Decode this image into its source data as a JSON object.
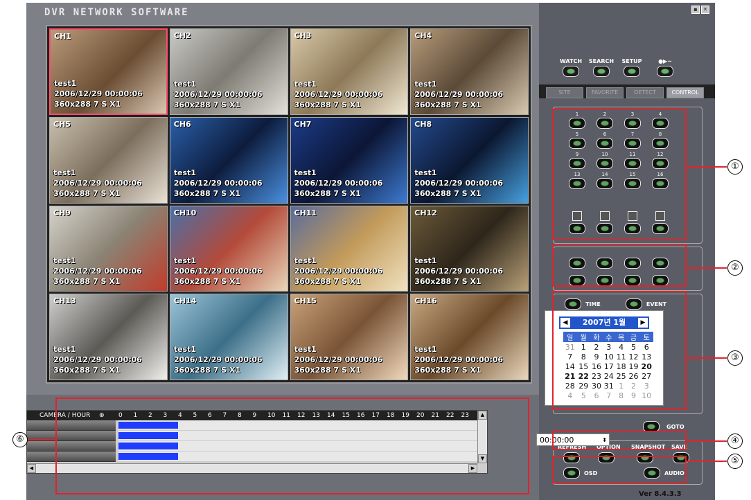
{
  "app": {
    "title": "DVR NETWORK SOFTWARE",
    "version": "Ver 8.4.3.3"
  },
  "window": {
    "minimize": "▪",
    "close": "✕"
  },
  "channels": [
    {
      "label": "CH1",
      "name": "test1",
      "ts": "2006/12/29 00:00:06",
      "info": "360x288 7 S X1",
      "bg": "linear-gradient(135deg,#b99a7a,#6b4d33 55%,#d8c7b2)"
    },
    {
      "label": "CH2",
      "name": "test1",
      "ts": "2006/12/29 00:00:06",
      "info": "360x288 7 S X1",
      "bg": "linear-gradient(135deg,#c9c9c7,#7d7b72 50%,#e2e0da)"
    },
    {
      "label": "CH3",
      "name": "test1",
      "ts": "2006/12/29 00:00:06",
      "info": "360x288 7 S X1",
      "bg": "linear-gradient(135deg,#d8c9a8,#8d7958 50%,#f0e7d2)"
    },
    {
      "label": "CH4",
      "name": "test1",
      "ts": "2006/12/29 00:00:06",
      "info": "360x288 7 S X1",
      "bg": "linear-gradient(135deg,#b89c7b,#5b4a37 50%,#d9c8b0)"
    },
    {
      "label": "CH5",
      "name": "test1",
      "ts": "2006/12/29 00:00:06",
      "info": "360x288 7 S X1",
      "bg": "linear-gradient(135deg,#c9bfae,#7c6e5c 50%,#e9e1d5)"
    },
    {
      "label": "CH6",
      "name": "test1",
      "ts": "2006/12/29 00:00:06",
      "info": "360x288 7 S X1",
      "bg": "linear-gradient(135deg,#2a5fa8,#0d1c3d 50%,#4a8fe0)"
    },
    {
      "label": "CH7",
      "name": "test1",
      "ts": "2006/12/29 00:00:06",
      "info": "360x288 7 S X1",
      "bg": "linear-gradient(135deg,#1c3c88,#0c1636 50%,#3d7ad0)"
    },
    {
      "label": "CH8",
      "name": "test1",
      "ts": "2006/12/29 00:00:06",
      "info": "360x288 7 S X1",
      "bg": "linear-gradient(135deg,#244a8e,#0b1730 50%,#47a0e0)"
    },
    {
      "label": "CH9",
      "name": "test1",
      "ts": "2006/12/29 00:00:06",
      "info": "360x288 7 S X1",
      "bg": "linear-gradient(135deg,#d6d3cc,#8a8374 50%,#c23c2a)"
    },
    {
      "label": "CH10",
      "name": "test1",
      "ts": "2006/12/29 00:00:06",
      "info": "360x288 7 S X1",
      "bg": "linear-gradient(135deg,#4a6fa8,#b34a3a 50%,#e8d6b8)"
    },
    {
      "label": "CH11",
      "name": "test1",
      "ts": "2006/12/29 00:00:06",
      "info": "360x288 7 S X1",
      "bg": "linear-gradient(135deg,#5a6c9c,#c29a5a 50%,#f0e2c0)"
    },
    {
      "label": "CH12",
      "name": "test1",
      "ts": "2006/12/29 00:00:06",
      "info": "360x288 7 S X1",
      "bg": "linear-gradient(135deg,#6b5a3a,#2e261a 50%,#b8a078)"
    },
    {
      "label": "CH13",
      "name": "test1",
      "ts": "2006/12/29 00:00:06",
      "info": "360x288 7 S X1",
      "bg": "linear-gradient(135deg,#cfcfcd,#5c5a55 50%,#f0efec)"
    },
    {
      "label": "CH14",
      "name": "test1",
      "ts": "2006/12/29 00:00:06",
      "info": "360x288 7 S X1",
      "bg": "linear-gradient(135deg,#9cc4d8,#3c6f88 50%,#e0eef4)"
    },
    {
      "label": "CH15",
      "name": "test1",
      "ts": "2006/12/29 00:00:06",
      "info": "360x288 7 S X1",
      "bg": "linear-gradient(135deg,#c9a27a,#7a5436 50%,#f0d9bd)"
    },
    {
      "label": "CH16",
      "name": "test1",
      "ts": "2006/12/29 00:00:06",
      "info": "360x288 7 S X1",
      "bg": "linear-gradient(135deg,#c8a882,#6b4a2a 50%,#e8d6bc)"
    }
  ],
  "timeline": {
    "header_label": "CAMERA / HOUR",
    "hours": [
      "0",
      "1",
      "2",
      "3",
      "4",
      "5",
      "6",
      "7",
      "8",
      "9",
      "10",
      "11",
      "12",
      "13",
      "14",
      "15",
      "16",
      "17",
      "18",
      "19",
      "20",
      "21",
      "22",
      "23"
    ],
    "recorded_hours": 4
  },
  "top_buttons": [
    "WATCH",
    "SEARCH",
    "SETUP"
  ],
  "tabs": [
    {
      "label": "SITE",
      "active": false
    },
    {
      "label": "FAVORITE",
      "active": false
    },
    {
      "label": "DETECT",
      "active": false
    },
    {
      "label": "CONTROL",
      "active": true
    }
  ],
  "channel_buttons": [
    "1",
    "2",
    "3",
    "4",
    "5",
    "6",
    "7",
    "8",
    "9",
    "10",
    "11",
    "12",
    "13",
    "14",
    "15",
    "16"
  ],
  "search": {
    "time_label": "TIME",
    "event_label": "EVENT",
    "goto_label": "GOTO",
    "time_value": "00:00:00"
  },
  "calendar": {
    "month_label": "2007년 1월",
    "weekdays": [
      "일",
      "월",
      "화",
      "수",
      "목",
      "금",
      "토"
    ],
    "weeks": [
      [
        "31",
        "1",
        "2",
        "3",
        "4",
        "5",
        "6"
      ],
      [
        "7",
        "8",
        "9",
        "10",
        "11",
        "12",
        "13"
      ],
      [
        "14",
        "15",
        "16",
        "17",
        "18",
        "19",
        "20"
      ],
      [
        "21",
        "22",
        "23",
        "24",
        "25",
        "26",
        "27"
      ],
      [
        "28",
        "29",
        "30",
        "31",
        "1",
        "2",
        "3"
      ],
      [
        "4",
        "5",
        "6",
        "7",
        "8",
        "9",
        "10"
      ]
    ]
  },
  "bottom_buttons": {
    "refresh": "REFRESH",
    "option": "OPTION",
    "snapshot": "SNAPSHOT",
    "save": "SAVE",
    "osd": "OSD",
    "audio": "AUDIO"
  },
  "callouts": [
    "①",
    "②",
    "③",
    "④",
    "⑤",
    "⑥"
  ],
  "colors": {
    "highlight": "#e0232e",
    "record": "#1f3dff",
    "calendar_header": "#2255cc"
  }
}
